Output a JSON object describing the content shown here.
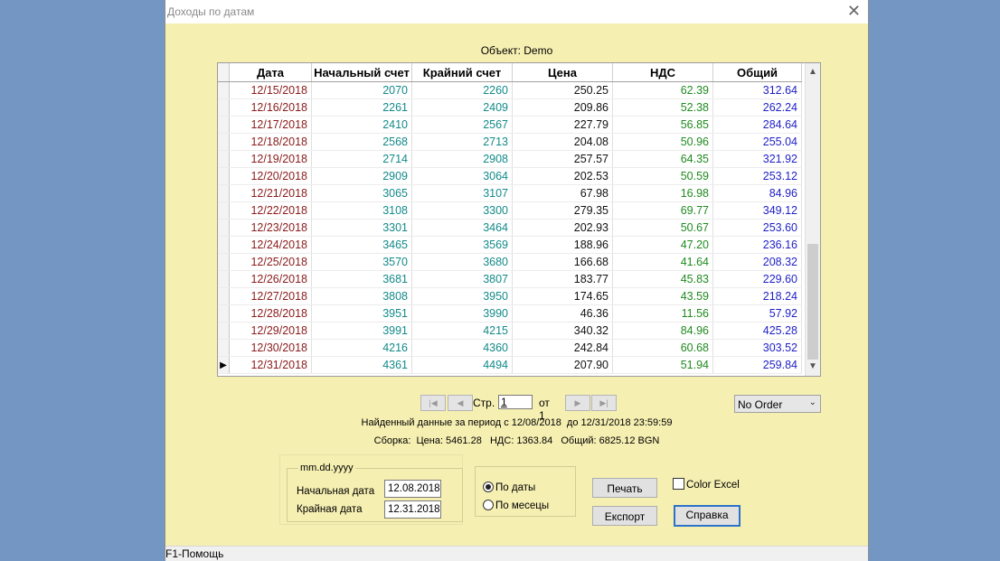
{
  "window": {
    "title": "Доходы по датам",
    "close_glyph": "✕"
  },
  "object_label": "Объект: Demo",
  "grid": {
    "columns": [
      "Дата",
      "Начальный счет",
      "Крайний счет",
      "Цена",
      "НДС",
      "Общий"
    ],
    "rows": [
      [
        "12/15/2018",
        "2070",
        "2260",
        "250.25",
        "62.39",
        "312.64"
      ],
      [
        "12/16/2018",
        "2261",
        "2409",
        "209.86",
        "52.38",
        "262.24"
      ],
      [
        "12/17/2018",
        "2410",
        "2567",
        "227.79",
        "56.85",
        "284.64"
      ],
      [
        "12/18/2018",
        "2568",
        "2713",
        "204.08",
        "50.96",
        "255.04"
      ],
      [
        "12/19/2018",
        "2714",
        "2908",
        "257.57",
        "64.35",
        "321.92"
      ],
      [
        "12/20/2018",
        "2909",
        "3064",
        "202.53",
        "50.59",
        "253.12"
      ],
      [
        "12/21/2018",
        "3065",
        "3107",
        "67.98",
        "16.98",
        "84.96"
      ],
      [
        "12/22/2018",
        "3108",
        "3300",
        "279.35",
        "69.77",
        "349.12"
      ],
      [
        "12/23/2018",
        "3301",
        "3464",
        "202.93",
        "50.67",
        "253.60"
      ],
      [
        "12/24/2018",
        "3465",
        "3569",
        "188.96",
        "47.20",
        "236.16"
      ],
      [
        "12/25/2018",
        "3570",
        "3680",
        "166.68",
        "41.64",
        "208.32"
      ],
      [
        "12/26/2018",
        "3681",
        "3807",
        "183.77",
        "45.83",
        "229.60"
      ],
      [
        "12/27/2018",
        "3808",
        "3950",
        "174.65",
        "43.59",
        "218.24"
      ],
      [
        "12/28/2018",
        "3951",
        "3990",
        "46.36",
        "11.56",
        "57.92"
      ],
      [
        "12/29/2018",
        "3991",
        "4215",
        "340.32",
        "84.96",
        "425.28"
      ],
      [
        "12/30/2018",
        "4216",
        "4360",
        "242.84",
        "60.68",
        "303.52"
      ],
      [
        "12/31/2018",
        "4361",
        "4494",
        "207.90",
        "51.94",
        "259.84"
      ]
    ],
    "current_row_index": 16,
    "current_row_marker": "▶"
  },
  "pager": {
    "first_glyph": "|◀",
    "prev_glyph": "◀",
    "next_glyph": "▶",
    "last_glyph": "▶|",
    "page_label": "Стр.",
    "page_value": "1",
    "of_label": "от 1"
  },
  "order_select": {
    "value": "No Order"
  },
  "info": {
    "period": "Найденный данные за период с 12/08/2018  до 12/31/2018 23:59:59",
    "summary": "Сборка:  Цена: 5461.28   НДС: 1363.84   Общий: 6825.12 BGN"
  },
  "date_group": {
    "legend": "mm.dd.yyyy",
    "start_label": "Начальная дата",
    "start_value": "12.08.2018",
    "end_label": "Крайная дата",
    "end_value": "12.31.2018"
  },
  "grouping": {
    "by_dates_label": "По даты",
    "by_months_label": "По месецы",
    "selected": "by_dates"
  },
  "buttons": {
    "print": "Печать",
    "export": "Експорт",
    "help": "Справка"
  },
  "color_excel": {
    "label": "Color Excel",
    "checked": false
  },
  "statusbar": {
    "text": "F1-Помощь"
  },
  "colors": {
    "window_bg": "#f6efb2",
    "desktop_bg": "#7396c2",
    "date_color": "#8b1a1a",
    "account_color": "#138a8a",
    "vat_color": "#1f8a1f",
    "total_color": "#1e1ec8"
  }
}
